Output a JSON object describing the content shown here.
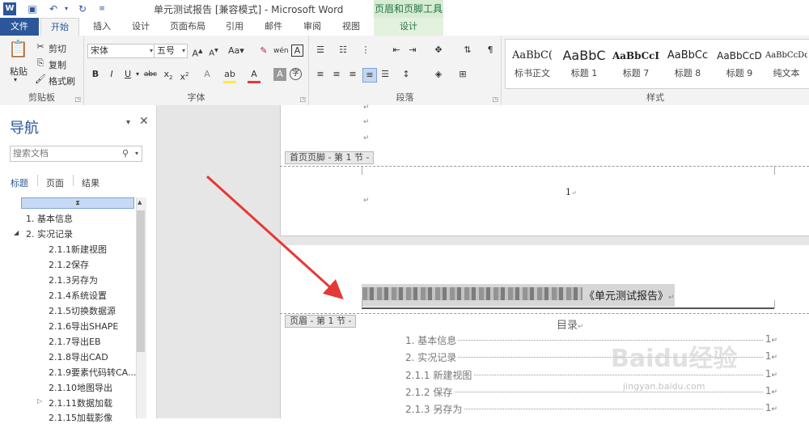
{
  "title_bar": {
    "document_title": "单元测试报告 [兼容模式] - Microsoft Word",
    "context_tool_title": "页眉和页脚工具",
    "quick_access": [
      "save-icon",
      "undo-icon",
      "redo-icon",
      "customize-icon"
    ]
  },
  "tabs": [
    {
      "label": "文件"
    },
    {
      "label": "开始"
    },
    {
      "label": "插入"
    },
    {
      "label": "设计"
    },
    {
      "label": "页面布局"
    },
    {
      "label": "引用"
    },
    {
      "label": "邮件"
    },
    {
      "label": "审阅"
    },
    {
      "label": "视图"
    },
    {
      "label": "设计"
    }
  ],
  "ribbon": {
    "clipboard": {
      "paste": "粘贴",
      "cut": "剪切",
      "copy": "复制",
      "format_painter": "格式刷",
      "label": "剪贴板"
    },
    "font": {
      "name": "宋体",
      "size": "五号",
      "label": "字体",
      "aa": "Aa"
    },
    "paragraph": {
      "label": "段落"
    },
    "styles": {
      "label": "样式",
      "items": [
        {
          "sample": "AaBbC(",
          "name": "标书正文"
        },
        {
          "sample": "AaBbC",
          "name": "标题 1"
        },
        {
          "sample": "AaBbCcI",
          "name": "标题 7"
        },
        {
          "sample": "AaBbCc",
          "name": "标题 8"
        },
        {
          "sample": "AaBbCcD",
          "name": "标题 9"
        },
        {
          "sample": "AaBbCcDd",
          "name": "纯文本"
        }
      ]
    }
  },
  "nav": {
    "title": "导航",
    "search_placeholder": "搜索文档",
    "tabs": [
      "标题",
      "页面",
      "结果"
    ],
    "tree": [
      {
        "label": "1. 基本信息"
      },
      {
        "label": "2. 实况记录"
      },
      {
        "label": "2.1.1新建视图"
      },
      {
        "label": "2.1.2保存"
      },
      {
        "label": "2.1.3另存为"
      },
      {
        "label": "2.1.4系统设置"
      },
      {
        "label": "2.1.5切换数据源"
      },
      {
        "label": "2.1.6导出SHAPE"
      },
      {
        "label": "2.1.7导出EB"
      },
      {
        "label": "2.1.8导出CAD"
      },
      {
        "label": "2.1.9要素代码转CA..."
      },
      {
        "label": "2.1.10地图导出"
      },
      {
        "label": "2.1.11数据加载"
      },
      {
        "label": "2.1.15加载影像"
      }
    ]
  },
  "document": {
    "footer_tag": "首页页脚 - 第 1 节 -",
    "page_number": "1",
    "header_tag": "页眉 - 第 1 节 -",
    "header_text": "《单元测试报告》",
    "toc_title": "目录",
    "toc": [
      {
        "label": "1.  基本信息",
        "page": "1"
      },
      {
        "label": "2.  实况记录",
        "page": "1"
      },
      {
        "label": "2.1.1 新建视图",
        "page": "1"
      },
      {
        "label": "2.1.2 保存",
        "page": "1"
      },
      {
        "label": "2.1.3 另存为",
        "page": "1"
      }
    ]
  },
  "watermark": {
    "text": "Baidu经验",
    "url": "jingyan.baidu.com"
  },
  "colors": {
    "word_blue": "#2b579a",
    "context_green": "#217346",
    "arrow_red": "#e53935"
  }
}
